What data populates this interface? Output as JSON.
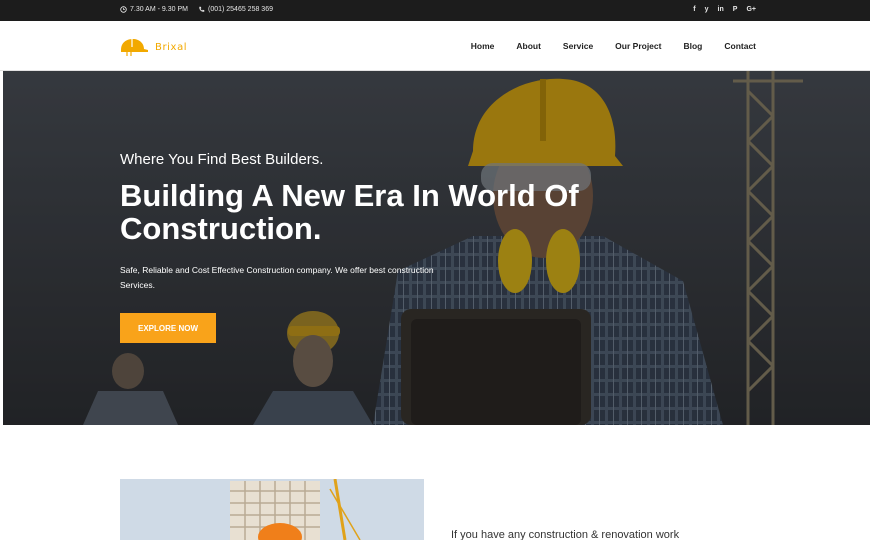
{
  "topbar": {
    "hours": "7.30 AM - 9.30 PM",
    "phone": "(001) 25465 258 369",
    "social": [
      "f",
      "y",
      "in",
      "P",
      "G+"
    ]
  },
  "nav": {
    "brand": "Brixal",
    "items": [
      "Home",
      "About",
      "Service",
      "Our Project",
      "Blog",
      "Contact"
    ]
  },
  "hero": {
    "subtitle": "Where You Find Best Builders.",
    "title": "Building A New Era In World Of Construction.",
    "description": "Safe, Reliable and Cost Effective Construction company. We offer best construction Services.",
    "button": "EXPLORE NOW"
  },
  "about": {
    "intro": "If you have any construction & renovation work"
  },
  "colors": {
    "accent": "#f9a31a",
    "topbar": "#1c1c1c"
  }
}
